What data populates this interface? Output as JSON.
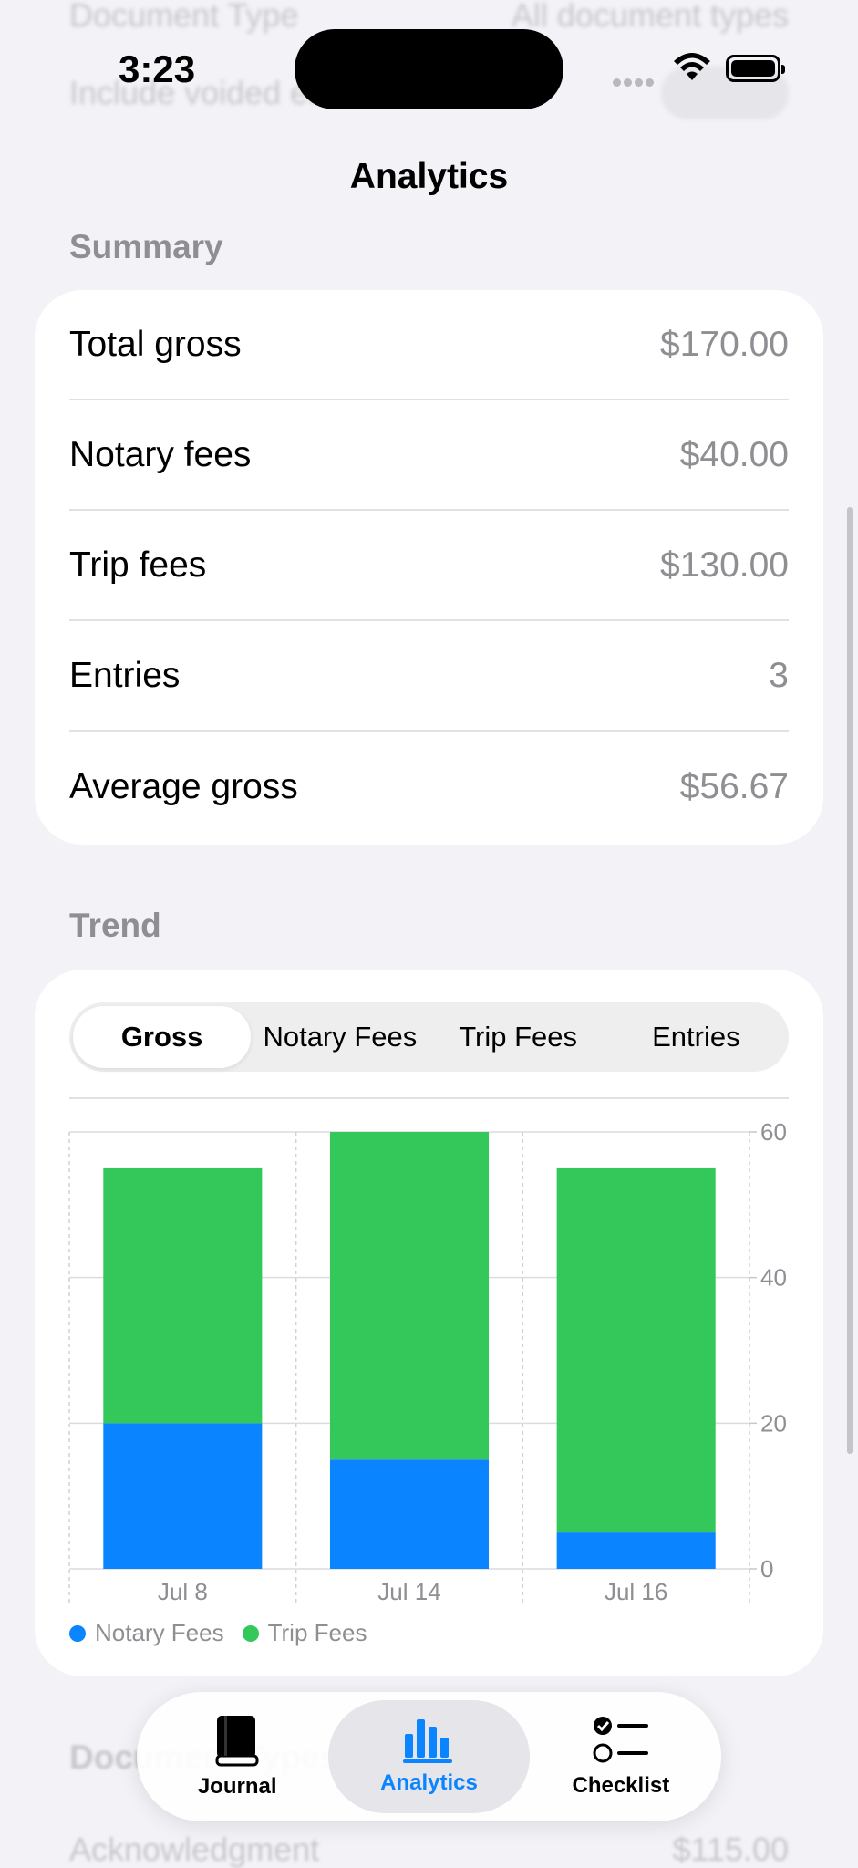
{
  "background_rows": {
    "doc_type_label": "Document Type",
    "doc_type_value": "All document types",
    "voided_label": "Include voided entries"
  },
  "status_bar": {
    "time": "3:23"
  },
  "nav": {
    "title": "Analytics"
  },
  "summary": {
    "header": "Summary",
    "rows": [
      {
        "label": "Total gross",
        "value": "$170.00"
      },
      {
        "label": "Notary fees",
        "value": "$40.00"
      },
      {
        "label": "Trip fees",
        "value": "$130.00"
      },
      {
        "label": "Entries",
        "value": "3"
      },
      {
        "label": "Average gross",
        "value": "$56.67"
      }
    ]
  },
  "trend": {
    "header": "Trend",
    "segments": [
      "Gross",
      "Notary Fees",
      "Trip Fees",
      "Entries"
    ],
    "selected_segment": "Gross"
  },
  "chart_data": {
    "type": "bar",
    "stacked": true,
    "categories": [
      "Jul 8",
      "Jul 14",
      "Jul 16"
    ],
    "series": [
      {
        "name": "Notary Fees",
        "values": [
          20,
          15,
          5
        ],
        "color": "#0a84ff"
      },
      {
        "name": "Trip Fees",
        "values": [
          35,
          45,
          50
        ],
        "color": "#34c759"
      }
    ],
    "yticks": [
      0,
      20,
      40,
      60
    ],
    "ylim": [
      0,
      60
    ],
    "y_axis_side": "right",
    "grid": true,
    "legend": "bottom-left"
  },
  "lower_section": {
    "header": "Document Types",
    "first_row_label": "Acknowledgment",
    "first_row_value": "$115.00"
  },
  "tab_bar": {
    "tabs": [
      {
        "label": "Journal",
        "icon": "book-icon"
      },
      {
        "label": "Analytics",
        "icon": "bar-chart-icon"
      },
      {
        "label": "Checklist",
        "icon": "checklist-icon"
      }
    ],
    "active": "Analytics",
    "accent": "#0a84ff"
  }
}
